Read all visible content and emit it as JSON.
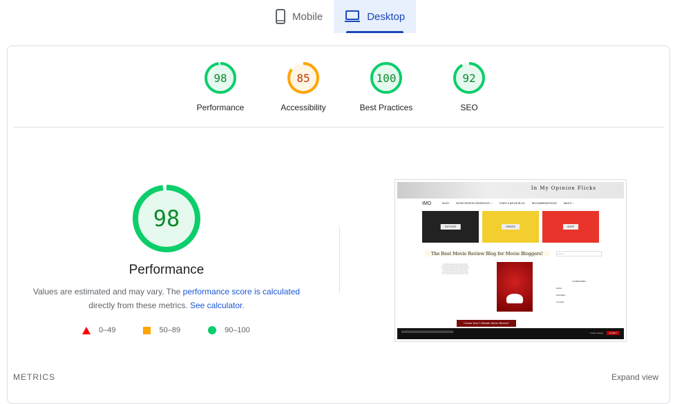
{
  "tabs": [
    {
      "label": "Mobile",
      "icon": "phone-icon",
      "active": false
    },
    {
      "label": "Desktop",
      "icon": "laptop-icon",
      "active": true
    }
  ],
  "colors": {
    "pass": "#0cce6b",
    "average": "#ffa400",
    "fail": "#ff3333",
    "accent": "#1a46b8"
  },
  "categories": [
    {
      "label": "Performance",
      "score": 98,
      "color": "#0cce6b",
      "text_color": "#0c8a2a"
    },
    {
      "label": "Accessibility",
      "score": 85,
      "color": "#ffa400",
      "text_color": "#c33300"
    },
    {
      "label": "Best Practices",
      "score": 100,
      "color": "#0cce6b",
      "text_color": "#0c8a2a"
    },
    {
      "label": "SEO",
      "score": 92,
      "color": "#0cce6b",
      "text_color": "#0c8a2a"
    }
  ],
  "main": {
    "score": 98,
    "title": "Performance",
    "desc_pre": "Values are estimated and may vary. The ",
    "desc_link": "performance score is calculated",
    "desc_mid": " directly from these metrics. ",
    "desc_link2": "See calculator",
    "desc_end": "."
  },
  "legend": [
    {
      "range": "0–49",
      "shape": "triangle",
      "color": "#ff3333"
    },
    {
      "range": "50–89",
      "shape": "square",
      "color": "#ffa400"
    },
    {
      "range": "90–100",
      "shape": "circle",
      "color": "#0cce6b"
    }
  ],
  "screenshot": {
    "site_title": "In My Opinion Flicks",
    "logo": "IMO",
    "nav": [
      "BLOG",
      "MOVIE REVIEW GENERATOR ⌄",
      "START A MOVIE BLOG",
      "RECOMMENDATIONS",
      "ABOUT ⌄"
    ],
    "tiles": [
      "EXPLORE",
      "CREATE",
      "SHOP"
    ],
    "heading": "The Best Movie Review Blog for Movie Bloggers!",
    "search": "Search",
    "side_heading": "CATEGORIES",
    "side_items": [
      "Action",
      "Animation",
      "Comedy"
    ],
    "cta": "Create Your 5 Minute Movie Review!",
    "cookie_accept": "ACCEPT",
    "cookie_settings": "Cookie settings"
  },
  "footer": {
    "metrics": "METRICS",
    "expand": "Expand view"
  }
}
